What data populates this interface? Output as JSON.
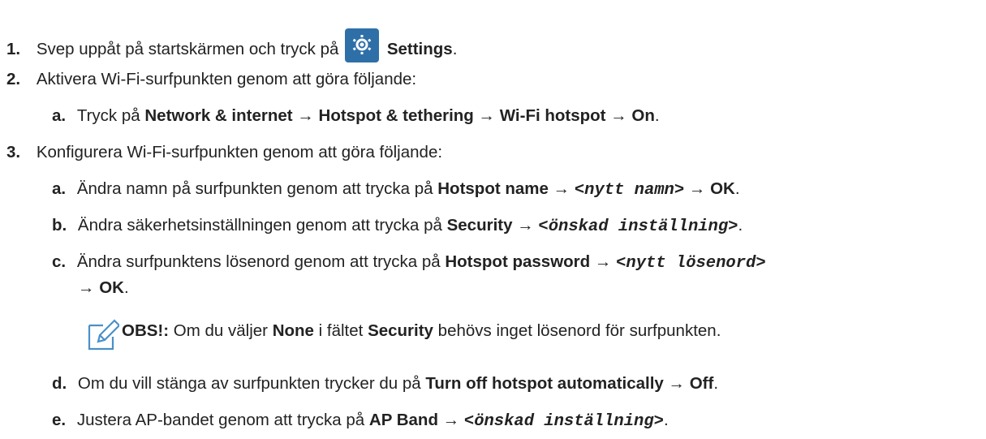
{
  "steps": [
    {
      "num": "1.",
      "text_before": "Svep uppåt på startskärmen och tryck på",
      "icon": "settings-gear-icon",
      "bold": "Settings",
      "after": "."
    },
    {
      "num": "2.",
      "text": "Aktivera Wi-Fi-surfpunkten genom att göra följande:",
      "sub": [
        {
          "letter": "a.",
          "pre": "Tryck på",
          "b1": "Network & internet",
          "arrow1": "→",
          "b2": "Hotspot & tethering",
          "arrow2": "→",
          "b3": "Wi-Fi hotspot",
          "arrow3": "→",
          "b4": "On",
          "end": "."
        }
      ]
    },
    {
      "num": "3.",
      "text": "Konfigurera Wi-Fi-surfpunkten genom att göra följande:",
      "sub": [
        {
          "letter": "a.",
          "pre": "Ändra namn på surfpunkten genom att trycka på",
          "b1": "Hotspot name",
          "arrow1": "→",
          "mono": "<nytt namn>",
          "arrow2": "→",
          "b2": "OK",
          "end": "."
        },
        {
          "letter": "b.",
          "pre": "Ändra säkerhetsinställningen genom att trycka på",
          "b1": "Security",
          "arrow1": "→",
          "mono": "<önskad inställning>",
          "end": "."
        },
        {
          "letter": "c.",
          "pre": "Ändra surfpunktens lösenord genom att trycka på",
          "b1": "Hotspot password",
          "arrow1": "→",
          "mono": "<nytt lösenord>",
          "arrow2": "→",
          "b2": "OK",
          "end": "."
        },
        {
          "letter": "d.",
          "pre": "Om du vill stänga av surfpunkten trycker du på",
          "b1": "Turn off hotspot automatically",
          "arrow1": "→",
          "b2": "Off",
          "end": "."
        },
        {
          "letter": "e.",
          "pre": "Justera AP-bandet genom att trycka på",
          "b1": "AP Band",
          "arrow1": "→",
          "mono": "<önskad inställning>",
          "end": "."
        }
      ]
    }
  ],
  "note": {
    "icon": "note-pencil-icon",
    "label": "OBS!:",
    "t1": "Om du väljer",
    "b1": "None",
    "t2": "i fältet",
    "b2": "Security",
    "t3": "behövs inget lösenord för surfpunkten."
  },
  "colors": {
    "text": "#222222",
    "gear_bg": "#2f6fa8",
    "note_icon": "#4a90c8"
  }
}
